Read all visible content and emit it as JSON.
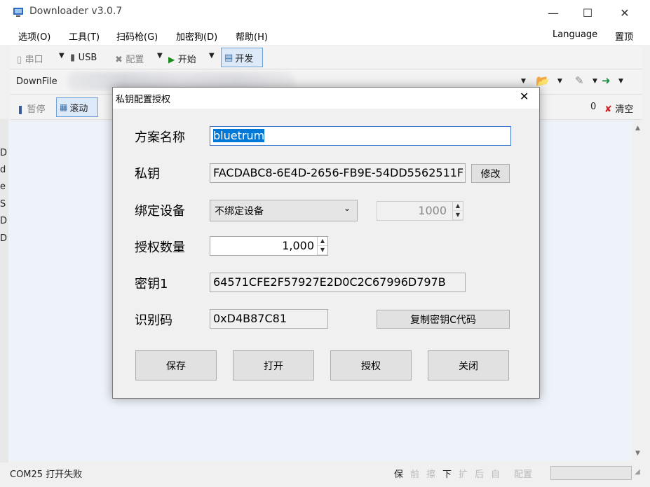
{
  "window": {
    "title": "Downloader v3.0.7"
  },
  "menu": {
    "items": [
      "选项(O)",
      "工具(T)",
      "扫码枪(G)",
      "加密狗(D)",
      "帮助(H)"
    ],
    "language": "Language",
    "pin": "置顶"
  },
  "toolbar": {
    "serial": "串口",
    "usb": "USB",
    "config": "配置",
    "start": "开始",
    "develop": "开发"
  },
  "filebar": {
    "label": "DownFile"
  },
  "ctrlbar": {
    "pause": "暂停",
    "scroll": "滚动",
    "count": "0",
    "clear": "清空"
  },
  "leftstrip": [
    "D",
    "d",
    "e",
    "S",
    "D",
    "D"
  ],
  "status": {
    "text": "COM25 打开失败",
    "chars": [
      "保",
      "前",
      "擦",
      "下",
      "扩",
      "后",
      "自"
    ],
    "config": "配置"
  },
  "dialog": {
    "title": "私钥配置授权",
    "scheme_label": "方案名称",
    "scheme_value": "bluetrum",
    "key_label": "私钥",
    "key_value": "FACDABC8-6E4D-2656-FB9E-54DD5562511F",
    "modify": "修改",
    "bind_label": "绑定设备",
    "bind_selected": "不绑定设备",
    "bind_count": "1000",
    "auth_label": "授权数量",
    "auth_value": "1,000",
    "key1_label": "密钥1",
    "key1_value": "64571CFE2F57927E2D0C2C67996D797B",
    "id_label": "识别码",
    "id_value": "0xD4B87C81",
    "copy": "复制密钥C代码",
    "buttons": {
      "save": "保存",
      "open": "打开",
      "authorize": "授权",
      "close": "关闭"
    }
  }
}
